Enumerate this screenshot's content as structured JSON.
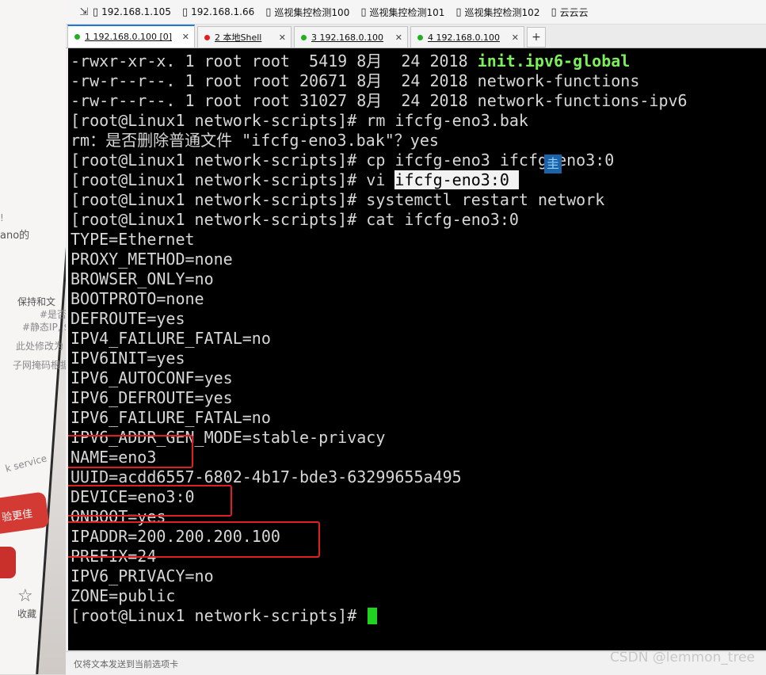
{
  "bookmarks": {
    "items": [
      {
        "label": "192.168.1.105"
      },
      {
        "label": "192.168.1.66"
      },
      {
        "label": "巡视集控检测100"
      },
      {
        "label": "巡视集控检测101"
      },
      {
        "label": "巡视集控检测102"
      },
      {
        "label": "云云云"
      }
    ]
  },
  "tabs": [
    {
      "label": "1 192.168.0.100 [0]",
      "status_color": "#20b020",
      "active": true
    },
    {
      "label": "2 本地Shell",
      "status_color": "#e02020",
      "active": false
    },
    {
      "label": "3 192.168.0.100",
      "status_color": "#20b020",
      "active": false
    },
    {
      "label": "4 192.168.0.100",
      "status_color": "#20b020",
      "active": false
    }
  ],
  "terminal": {
    "lines": [
      {
        "text": "-rwxr-xr-x. 1 root root  5419 8月  24 2018 ",
        "highlight": "init.ipv6-global"
      },
      {
        "text": "-rw-r--r--. 1 root root 20671 8月  24 2018 network-functions"
      },
      {
        "text": "-rw-r--r--. 1 root root 31027 8月  24 2018 network-functions-ipv6"
      },
      {
        "text": "[root@Linux1 network-scripts]# rm ifcfg-eno3.bak"
      },
      {
        "text": "rm：是否删除普通文件 \"ifcfg-eno3.bak\"？yes"
      },
      {
        "text": "[root@Linux1 network-scripts]# cp ifcfg-eno3 ifcfg-eno3:0"
      },
      {
        "text": "[root@Linux1 network-scripts]# vi ",
        "selected": "ifcfg-eno3:0 "
      },
      {
        "text": "[root@Linux1 network-scripts]# systemctl restart network"
      },
      {
        "text": "[root@Linux1 network-scripts]# cat ifcfg-eno3:0"
      },
      {
        "text": "TYPE=Ethernet"
      },
      {
        "text": "PROXY_METHOD=none"
      },
      {
        "text": "BROWSER_ONLY=no"
      },
      {
        "text": "BOOTPROTO=none"
      },
      {
        "text": "DEFROUTE=yes"
      },
      {
        "text": "IPV4_FAILURE_FATAL=no"
      },
      {
        "text": "IPV6INIT=yes"
      },
      {
        "text": "IPV6_AUTOCONF=yes"
      },
      {
        "text": "IPV6_DEFROUTE=yes"
      },
      {
        "text": "IPV6_FAILURE_FATAL=no"
      },
      {
        "text": "IPV6_ADDR_GEN_MODE=stable-privacy"
      },
      {
        "text": "NAME=eno3"
      },
      {
        "text": "UUID=acdd6557-6802-4b17-bde3-63299655a495"
      },
      {
        "text": "DEVICE=eno3:0"
      },
      {
        "text": "ONBOOT=yes"
      },
      {
        "text": "IPADDR=200.200.200.100"
      },
      {
        "text": "PREFIX=24"
      },
      {
        "text": "IPV6_PRIVACY=no"
      },
      {
        "text": "ZONE=public"
      },
      {
        "text": "[root@Linux1 network-scripts]# ",
        "cursor": true
      }
    ],
    "ime_char": "圭"
  },
  "status_bar": {
    "hint": "仅将文本发送到当前选项卡"
  },
  "watermark": "CSDN @lemmon_tree",
  "phone_fragments": {
    "frag1": "ano的",
    "frag2": "保持和文",
    "frag3": "#是否",
    "frag4": "#静态IP, $",
    "frag5": "此处修改为",
    "frag6": "子网掩码根据",
    "frag7": "k service",
    "frag8": "验更佳",
    "frag9": "收藏"
  },
  "colors": {
    "terminal_bg": "#000000",
    "terminal_fg": "#d7d7d7",
    "highlight_green": "#7cf05a",
    "cursor_green": "#21d321",
    "annotation_red": "#e02020",
    "tab_accent": "#1e78d6"
  }
}
